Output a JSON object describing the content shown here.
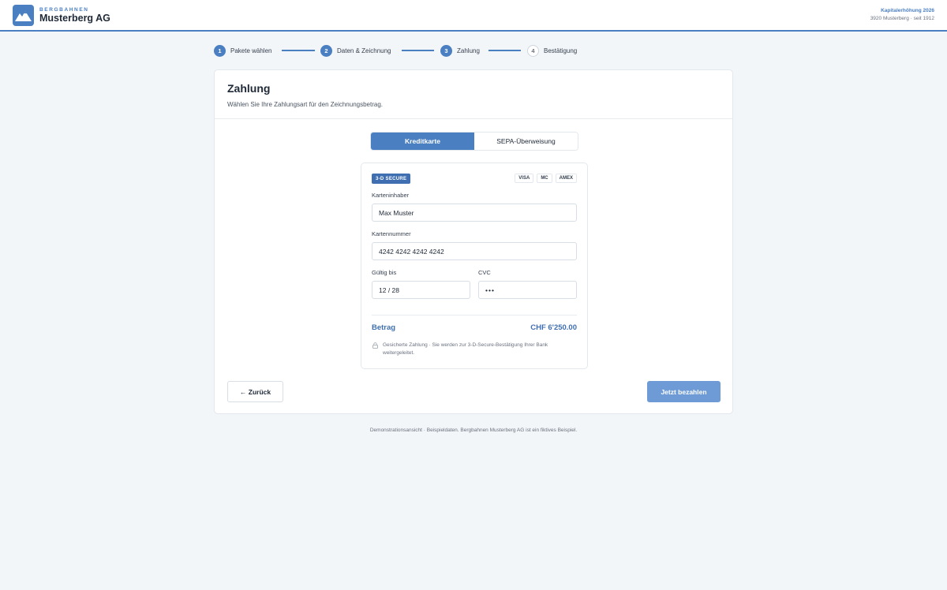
{
  "header": {
    "brand_small": "BERGBAHNEN",
    "brand_name": "Musterberg AG",
    "campaign": "Kapitalerhöhung 2026",
    "location": "3920 Musterberg · seit 1912"
  },
  "stepper": {
    "steps": [
      {
        "number": "1",
        "label": "Pakete wählen",
        "state": "done"
      },
      {
        "number": "2",
        "label": "Daten & Zeichnung",
        "state": "done"
      },
      {
        "number": "3",
        "label": "Zahlung",
        "state": "current"
      },
      {
        "number": "4",
        "label": "Bestätigung",
        "state": "todo"
      }
    ]
  },
  "card": {
    "title": "Zahlung",
    "subtitle": "Wählen Sie Ihre Zahlungsart für den Zeichnungsbetrag."
  },
  "tabs": {
    "credit_card": "Kreditkarte",
    "sepa": "SEPA-Überweisung",
    "selected": "Kreditkarte"
  },
  "payment": {
    "secure_badge": "3-D SECURE",
    "brands": [
      "VISA",
      "MC",
      "AMEX"
    ],
    "holder_label": "Karteninhaber",
    "holder_value": "Max Muster",
    "number_label": "Kartennummer",
    "number_value": "4242 4242 4242 4242",
    "expiry_label": "Gültig bis",
    "expiry_value": "12 / 28",
    "cvc_label": "CVC",
    "cvc_value": "•••",
    "amount_label": "Betrag",
    "amount_value": "CHF 6'250.00",
    "note": "Gesicherte Zahlung · Sie werden zur 3-D-Secure-Bestätigung Ihrer Bank weitergeleitet."
  },
  "actions": {
    "back": "← Zurück",
    "pay": "Jetzt bezahlen"
  },
  "footer": {
    "text": "Demonstrationsansicht · Beispieldaten. Bergbahnen Musterberg AG ist ein fiktives Beispiel."
  },
  "colors": {
    "accent": "#4a7fc1",
    "accent_dark": "#3f6fb0",
    "pay_button": "#6e9bd6",
    "background": "#f3f6f8"
  }
}
